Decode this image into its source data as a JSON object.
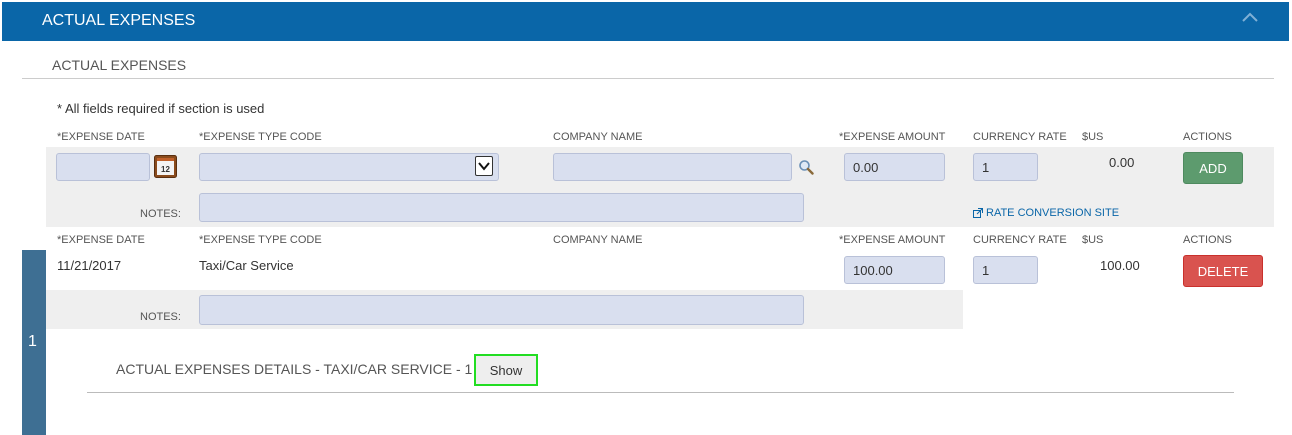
{
  "header": {
    "title": "ACTUAL EXPENSES"
  },
  "section": {
    "title": "ACTUAL EXPENSES",
    "required_note": "* All fields required if section is used"
  },
  "columns": {
    "expense_date": "*EXPENSE DATE",
    "expense_type_code": "*EXPENSE TYPE CODE",
    "company_name": "COMPANY NAME",
    "expense_amount": "*EXPENSE AMOUNT",
    "currency_rate": "CURRENCY RATE",
    "usd": "$US",
    "actions": "ACTIONS"
  },
  "entry": {
    "expense_date": "",
    "expense_type_code": "",
    "company_name": "",
    "expense_amount": "0.00",
    "currency_rate": "1",
    "usd": "0.00",
    "notes_label": "NOTES:",
    "notes": "",
    "add_label": "ADD",
    "rate_link": "RATE CONVERSION SITE"
  },
  "rows": [
    {
      "number": "1",
      "expense_date": "11/21/2017",
      "expense_type_code": "Taxi/Car Service",
      "company_name": "",
      "expense_amount": "100.00",
      "currency_rate": "1",
      "usd": "100.00",
      "notes_label": "NOTES:",
      "notes": "",
      "delete_label": "DELETE",
      "details_title": "ACTUAL EXPENSES DETAILS - TAXI/CAR SERVICE - 1",
      "show_label": "Show"
    }
  ],
  "icons": {
    "collapse": "chevron-up-icon",
    "calendar": "calendar-icon",
    "lookup": "magnifier-icon",
    "external_link": "external-link-icon"
  },
  "colors": {
    "header": "#0a66a8",
    "add": "#5d9b6e",
    "delete": "#d9534f",
    "highlight": "#22dd22",
    "row_number_bar": "#3e6f93"
  }
}
